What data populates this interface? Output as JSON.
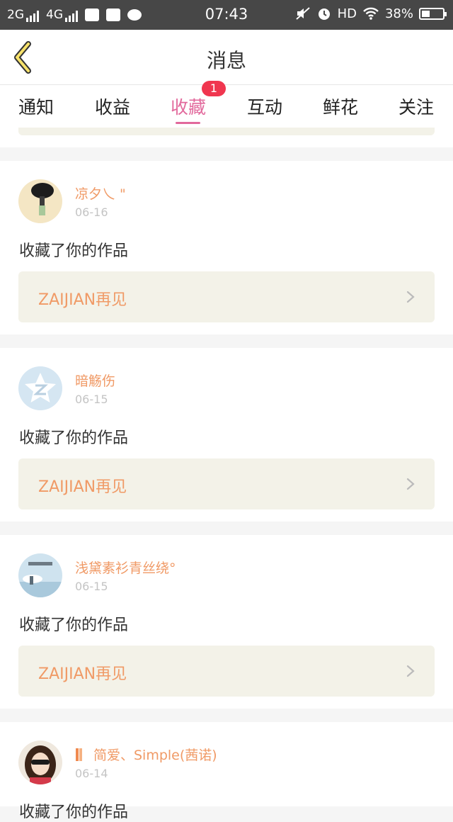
{
  "status_bar": {
    "net1": "2G",
    "net2": "4G",
    "time": "07:43",
    "hd": "HD",
    "battery": "38%",
    "battery_level": 0.38
  },
  "header": {
    "title": "消息"
  },
  "tabs": [
    {
      "label": "通知"
    },
    {
      "label": "收益"
    },
    {
      "label": "收藏",
      "badge": "1"
    },
    {
      "label": "互动"
    },
    {
      "label": "鲜花"
    },
    {
      "label": "关注"
    }
  ],
  "active_tab_color": "#e2699c",
  "items": [
    {
      "user": "凉夕乀 \"",
      "date": "06-16",
      "action": "收藏了你的作品",
      "work": "ZAIJIAN再见"
    },
    {
      "user": "暗觞伤",
      "date": "06-15",
      "action": "收藏了你的作品",
      "work": "ZAIJIAN再见"
    },
    {
      "user": "浅黛素衫青丝绕°",
      "date": "06-15",
      "action": "收藏了你的作品",
      "work": "ZAIJIAN再见"
    },
    {
      "user": "简爱、Simple(茜诺)",
      "date": "06-14",
      "action": "收藏了你的作品",
      "work": ""
    }
  ],
  "colors": {
    "username": "#f09a66",
    "work_bg": "#f3f2e8",
    "badge": "#f0364f"
  }
}
